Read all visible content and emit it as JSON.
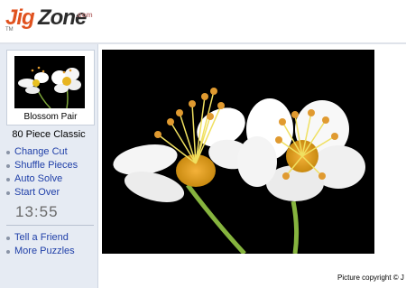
{
  "logo": {
    "jig": "Jig",
    "zone": "Zone",
    "dotcom": ".com",
    "tm": "TM"
  },
  "sidebar": {
    "thumbnail_caption": "Blossom Pair",
    "piece_info": "80 Piece Classic",
    "menu": [
      {
        "label": "Change Cut"
      },
      {
        "label": "Shuffle Pieces"
      },
      {
        "label": "Auto Solve"
      },
      {
        "label": "Start Over"
      }
    ],
    "timer": "13:55",
    "menu2": [
      {
        "label": "Tell a Friend"
      },
      {
        "label": "More Puzzles"
      }
    ]
  },
  "footer": {
    "copyright": "Picture copyright © J"
  },
  "colors": {
    "logo_orange": "#e0521f",
    "link_blue": "#1f3fa8",
    "sidebar_bg": "#e6ebf3"
  }
}
